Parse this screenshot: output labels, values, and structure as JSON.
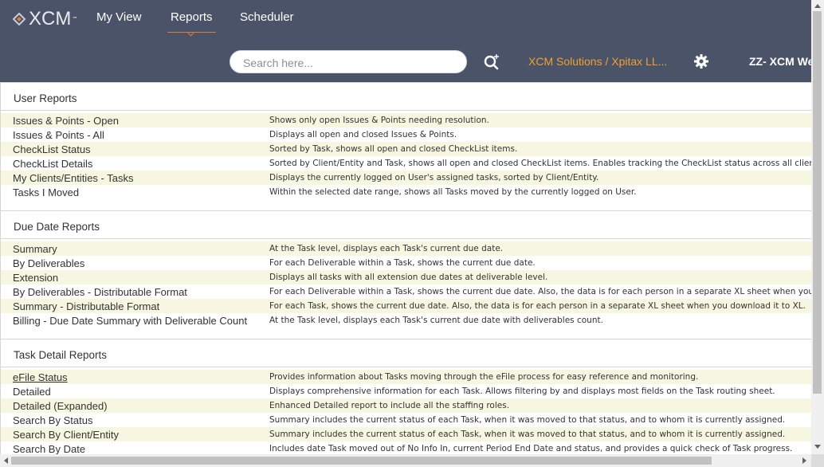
{
  "app": {
    "logo_text": "XCM",
    "logo_tm": "™"
  },
  "nav": [
    {
      "label": "My View",
      "active": false
    },
    {
      "label": "Reports",
      "active": true
    },
    {
      "label": "Scheduler",
      "active": false
    }
  ],
  "search": {
    "placeholder": "Search here...",
    "value": ""
  },
  "header": {
    "org_link": "XCM Solutions / Xpitax LL...",
    "user_name": "ZZ- XCM We",
    "accent_color": "#f0a030",
    "header_bg": "#4a5368"
  },
  "sections": [
    {
      "title": "User Reports",
      "rows": [
        {
          "name": "Issues & Points - Open",
          "desc": "Shows only open Issues & Points needing resolution."
        },
        {
          "name": "Issues & Points - All",
          "desc": "Displays all open and closed Issues & Points."
        },
        {
          "name": "CheckList Status",
          "desc": "Sorted by Task, shows all open and closed CheckList items."
        },
        {
          "name": "CheckList Details",
          "desc": "Sorted by Client/Entity and Task, shows all open and closed CheckList items. Enables tracking the CheckList status across all clients/entities"
        },
        {
          "name": "My Clients/Entities - Tasks",
          "desc": "Displays the currently logged on User's assigned tasks, sorted by Client/Entity."
        },
        {
          "name": "Tasks I Moved",
          "desc": "Within the selected date range, shows all Tasks moved by the currently logged on User."
        }
      ]
    },
    {
      "title": "Due Date Reports",
      "rows": [
        {
          "name": "Summary",
          "desc": "At the Task level, displays each Task's current due date."
        },
        {
          "name": "By Deliverables",
          "desc": "For each Deliverable within a Task, shows the current due date."
        },
        {
          "name": "Extension",
          "desc": "Displays all tasks with all extension due dates at deliverable level."
        },
        {
          "name": "By Deliverables - Distributable Format",
          "desc": "For each Deliverable within a Task, shows the current due date. Also, the data is for each person in a separate XL sheet when you download"
        },
        {
          "name": "Summary - Distributable Format",
          "desc": "For each Task, shows the current due date. Also, the data is for each person in a separate XL sheet when you download it to XL."
        },
        {
          "name": "Billing - Due Date Summary with Deliverable Count",
          "desc": "At the Task level, displays each Task's current due date with deliverables count."
        }
      ]
    },
    {
      "title": "Task Detail Reports",
      "rows": [
        {
          "name": "eFile Status",
          "desc": "Provides information about Tasks moving through the eFile process for easy reference and monitoring.",
          "hovered": true
        },
        {
          "name": "Detailed",
          "desc": "Displays comprehensive information for each Task. Allows filtering by and displays most fields on the Task routing sheet."
        },
        {
          "name": "Detailed (Expanded)",
          "desc": "Enhanced Detailed report to include all the staffing roles."
        },
        {
          "name": "Search By Status",
          "desc": "Summary includes the current status of each Task, when it was moved to that status, and to whom it is currently assigned."
        },
        {
          "name": "Search By Client/Entity",
          "desc": "Summary includes the current status of each Task, when it was moved to that status, and to whom it is currently assigned."
        },
        {
          "name": "Search By Date",
          "desc": "Includes date Task moved out of No Info In, current Period End Date and status, and provides a quick check of Task progress."
        }
      ]
    }
  ]
}
